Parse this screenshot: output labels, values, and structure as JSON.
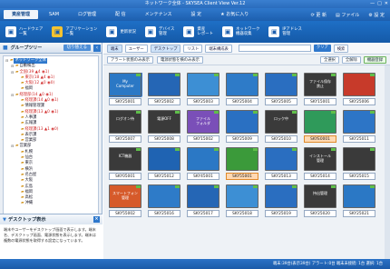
{
  "window": {
    "title": "ネットワーク全体 - SKYSEA Client View Ver.12",
    "buttons": [
      "—",
      "□",
      "✕"
    ]
  },
  "menu": {
    "items": [
      "資産管理",
      "SAM",
      "ログ管理",
      "配 信",
      "メンテナンス",
      "設 定",
      "お気に入り"
    ],
    "right": [
      "更 新",
      "ファイル",
      "設 定"
    ]
  },
  "toolbar": {
    "items": [
      {
        "label": "ハードウェア\n一覧",
        "icon": "hardware-icon",
        "color": "#ffffff"
      },
      {
        "label": "アプリケーション\n一覧",
        "icon": "app-icon",
        "color": "#f5c330"
      },
      {
        "label": "更新状況",
        "icon": "update-icon",
        "color": "#ffffff"
      },
      {
        "label": "デバイス\n管理",
        "icon": "device-icon",
        "color": "#ffffff"
      },
      {
        "label": "資産\nレポート",
        "icon": "report-icon",
        "color": "#ffffff"
      },
      {
        "label": "ネットワーク\n機器収集",
        "icon": "network-icon",
        "color": "#ffffff"
      },
      {
        "label": "IPアドレス\n管理",
        "icon": "ip-icon",
        "color": "#ffffff"
      }
    ]
  },
  "left": {
    "header": "グループツリー",
    "switch_label": "切り替える",
    "tree": [
      {
        "text": "ネットワーク全体",
        "level": 0,
        "sel": true,
        "red": false
      },
      {
        "text": "自動検出",
        "level": 1,
        "sel": false,
        "red": false
      },
      {
        "text": "全国(39 ▲4 ◉1)",
        "level": 1,
        "sel": false,
        "red": true
      },
      {
        "text": "東京(18 ▲4 ◉1)",
        "level": 2,
        "sel": false,
        "red": true
      },
      {
        "text": "大阪(12 ▲0 ◉0)",
        "level": 2,
        "sel": false,
        "red": true
      },
      {
        "text": "福岡",
        "level": 2,
        "sel": false,
        "red": false
      },
      {
        "text": "経理部(14 ▲0 ◉1)",
        "level": 1,
        "sel": false,
        "red": true
      },
      {
        "text": "経理課(14 ▲0 ◉1)",
        "level": 2,
        "sel": false,
        "red": true
      },
      {
        "text": "情報管理課",
        "level": 2,
        "sel": false,
        "red": false
      },
      {
        "text": "経理課(13 ▲0 ◉1)",
        "level": 2,
        "sel": false,
        "red": true
      },
      {
        "text": "人事課",
        "level": 2,
        "sel": false,
        "red": false
      },
      {
        "text": "広報課",
        "level": 2,
        "sel": false,
        "red": false
      },
      {
        "text": "経理課(13 ▲1 ◉0)",
        "level": 2,
        "sel": false,
        "red": true
      },
      {
        "text": "表示課",
        "level": 2,
        "sel": false,
        "red": false
      },
      {
        "text": "営業部",
        "level": 2,
        "sel": false,
        "red": false
      },
      {
        "text": "営業部",
        "level": 1,
        "sel": false,
        "red": false
      },
      {
        "text": "札幌",
        "level": 2,
        "sel": false,
        "red": false
      },
      {
        "text": "仙台",
        "level": 2,
        "sel": false,
        "red": false
      },
      {
        "text": "東京",
        "level": 2,
        "sel": false,
        "red": false
      },
      {
        "text": "横浜",
        "level": 2,
        "sel": false,
        "red": false
      },
      {
        "text": "名古屋",
        "level": 2,
        "sel": false,
        "red": false
      },
      {
        "text": "大阪",
        "level": 2,
        "sel": false,
        "red": false
      },
      {
        "text": "広島",
        "level": 2,
        "sel": false,
        "red": false
      },
      {
        "text": "福岡",
        "level": 2,
        "sel": false,
        "red": false
      },
      {
        "text": "高松",
        "level": 2,
        "sel": false,
        "red": false
      },
      {
        "text": "沖縄",
        "level": 2,
        "sel": false,
        "red": false
      }
    ],
    "help": {
      "title": "デスクトップ表示",
      "text": "端末やユーザーをデスクトップ画面で表示します。端末名、デスクトップ画面、電源状態を表示します。端末は複数の電源状態を取得する設定になっています。"
    }
  },
  "main": {
    "viewbar": [
      "端末",
      "ユーザー",
      "デスクトップ",
      "リスト",
      "端末構成表"
    ],
    "clear_label": "クリア",
    "search_label": "検索",
    "abar_left": [
      "アラート状態のみ表示",
      "電源状態を横のみ表示"
    ],
    "abar_right": [
      "全選択",
      "全解除",
      "機器登録"
    ],
    "cards": [
      {
        "name": "SKY25001",
        "bg": "#2b78c5",
        "text": "My\nComputer",
        "hi": false
      },
      {
        "name": "SKY25002",
        "bg": "#2566b5",
        "text": "",
        "hi": false
      },
      {
        "name": "SKY25003",
        "bg": "#3d8fd4",
        "text": "",
        "hi": false
      },
      {
        "name": "SKY25004",
        "bg": "#2e7bc8",
        "text": "",
        "hi": false
      },
      {
        "name": "SKY25005",
        "bg": "#2a6ec0",
        "text": "",
        "hi": false
      },
      {
        "name": "SKY15001",
        "bg": "#3a3a3a",
        "text": "ファイル保存\n禁止",
        "hi": false
      },
      {
        "name": "SKY25006",
        "bg": "#c73a2a",
        "text": "",
        "hi": false
      },
      {
        "name": "SKY25007",
        "bg": "#3a3a3a",
        "text": "ログオン待",
        "hi": false
      },
      {
        "name": "SKY25008",
        "bg": "#3a3a3a",
        "text": "電源OFF",
        "hi": false
      },
      {
        "name": "SKY15002",
        "bg": "#7a4fb8",
        "text": "ファイル\nフォルダ",
        "hi": false
      },
      {
        "name": "SKY25009",
        "bg": "#2a70c2",
        "text": "",
        "hi": false
      },
      {
        "name": "SKY25010",
        "bg": "#3a3a3a",
        "text": "ロック中",
        "hi": false
      },
      {
        "name": "SKYE0001",
        "bg": "#2f9a5a",
        "text": "",
        "hi": true
      },
      {
        "name": "SKY25011",
        "bg": "#2d75c6",
        "text": "",
        "hi": false
      },
      {
        "name": "SKY05001",
        "bg": "#3a3a3a",
        "text": "ICT機器",
        "hi": false
      },
      {
        "name": "SKY25012",
        "bg": "#1f63b2",
        "text": "",
        "hi": false
      },
      {
        "name": "SKY45001",
        "bg": "#2b78c5",
        "text": "",
        "hi": false
      },
      {
        "name": "SKY55001",
        "bg": "#3b9a3a",
        "text": "",
        "hi": true
      },
      {
        "name": "SKY25013",
        "bg": "#2a6ec0",
        "text": "",
        "hi": false
      },
      {
        "name": "SKY25014",
        "bg": "#3a3a3a",
        "text": "インストール\n管理",
        "hi": false
      },
      {
        "name": "SKY25015",
        "bg": "#3a3a3a",
        "text": "",
        "hi": false
      },
      {
        "name": "SKY55002",
        "bg": "#d65a2a",
        "text": "スマートフォン\n管理",
        "hi": false
      },
      {
        "name": "SKY25016",
        "bg": "#2e7bc8",
        "text": "",
        "hi": false
      },
      {
        "name": "SKY25017",
        "bg": "#2566b5",
        "text": "",
        "hi": false
      },
      {
        "name": "SKY25018",
        "bg": "#3d8fd4",
        "text": "",
        "hi": false
      },
      {
        "name": "SKY25019",
        "bg": "#2a6ec0",
        "text": "",
        "hi": false
      },
      {
        "name": "SKY25020",
        "bg": "#3a3a3a",
        "text": "持出管理",
        "hi": false
      },
      {
        "name": "SKY25021",
        "bg": "#2b78c5",
        "text": "",
        "hi": false
      }
    ]
  },
  "status": "端末:39台(表示39台) アラート:0台 端末未接続: 1台 選択: 1台"
}
